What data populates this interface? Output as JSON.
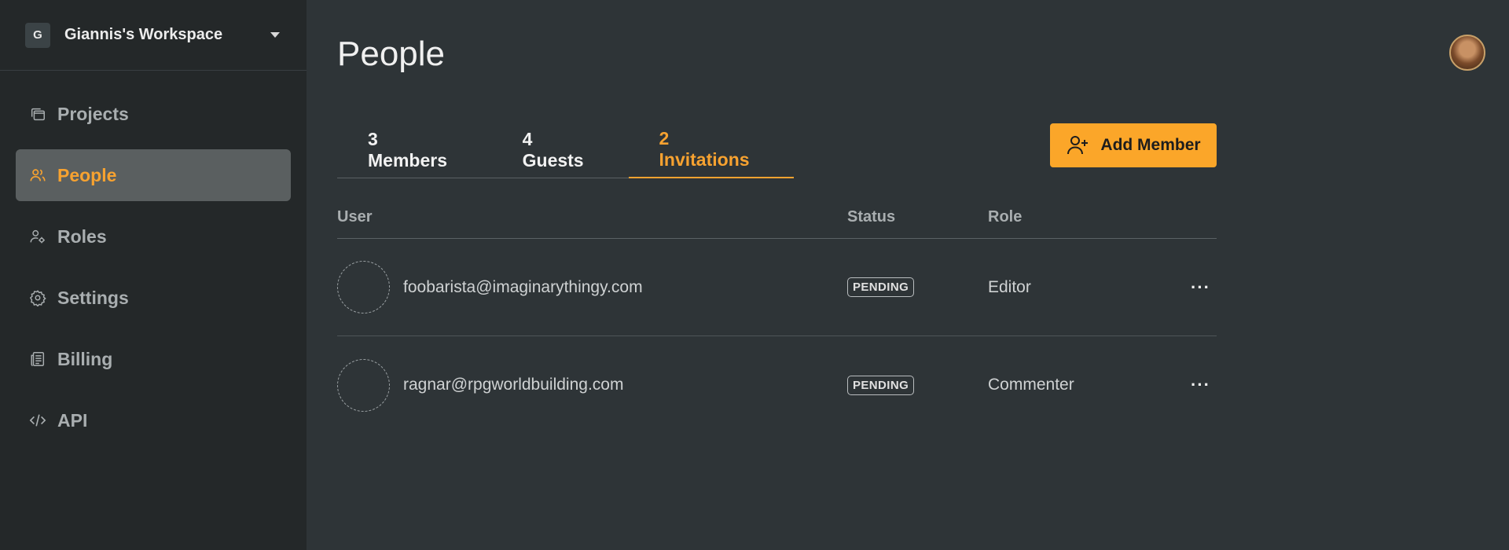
{
  "workspace": {
    "initial": "G",
    "name": "Giannis's Workspace",
    "caret_icon": "caret-down-icon"
  },
  "sidebar": {
    "items": [
      {
        "label": "Projects",
        "icon": "folders-icon",
        "active": false
      },
      {
        "label": "People",
        "icon": "users-icon",
        "active": true
      },
      {
        "label": "Roles",
        "icon": "user-gear-icon",
        "active": false
      },
      {
        "label": "Settings",
        "icon": "gear-icon",
        "active": false
      },
      {
        "label": "Billing",
        "icon": "receipt-icon",
        "active": false
      },
      {
        "label": "API",
        "icon": "code-icon",
        "active": false
      }
    ]
  },
  "main": {
    "title": "People",
    "tabs": [
      {
        "label": "3 Members",
        "active": false
      },
      {
        "label": "4 Guests",
        "active": false
      },
      {
        "label": "2 Invitations",
        "active": true
      }
    ],
    "add_member_label": "Add Member",
    "table": {
      "headers": {
        "user": "User",
        "status": "Status",
        "role": "Role"
      },
      "rows": [
        {
          "email": "foobarista@imaginarythingy.com",
          "status": "PENDING",
          "role": "Editor"
        },
        {
          "email": "ragnar@rpgworldbuilding.com",
          "status": "PENDING",
          "role": "Commenter"
        }
      ],
      "more_glyph": "···"
    }
  },
  "colors": {
    "accent": "#f7a230",
    "button": "#fba629",
    "sidebar_bg": "#242829",
    "main_bg": "#2e3437",
    "active_nav_bg": "#5a5f60"
  }
}
